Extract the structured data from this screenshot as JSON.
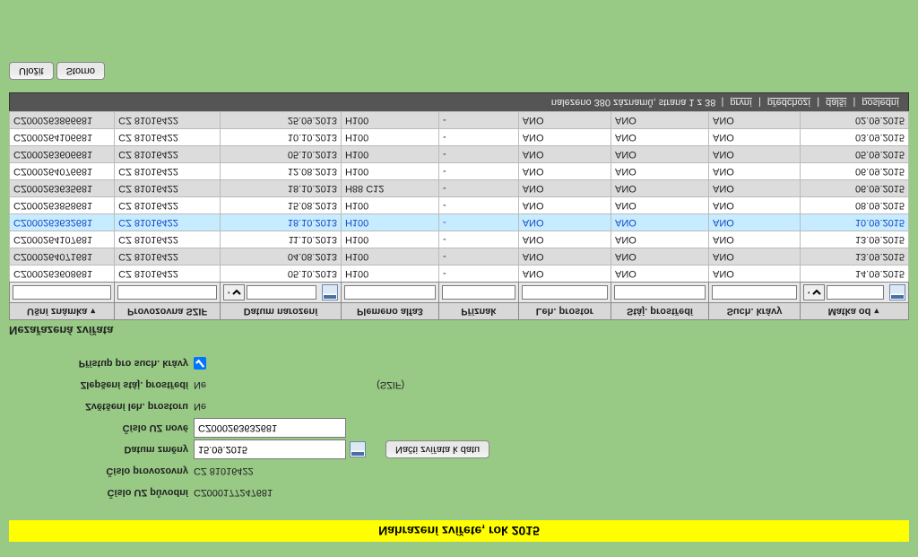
{
  "header": {
    "title": "Nahrazení zvířete, rok 2015"
  },
  "form": {
    "labels": {
      "orig_uz": "Číslo UZ původní",
      "farm_no": "Číslo provozovny",
      "change_date": "Datum změny",
      "new_uz": "Číslo UZ nové",
      "enlarge_space": "Zvětšení leh. prostoru",
      "improve_env": "Zlepšení stáj. prostředí",
      "dry_cows_access": "Přístup pro such. krávy"
    },
    "values": {
      "orig_uz": "CZ000177247681",
      "farm_no": "CZ 81016422",
      "change_date": "15.09.2015",
      "new_uz": "CZ000263632681",
      "enlarge_space": "Ne",
      "improve_env": "Ne",
      "szif_note": "(SZIF)"
    },
    "buttons": {
      "load_animals": "Načti zvířata k datu",
      "save": "Uložit",
      "cancel": "Storno"
    }
  },
  "section_title": "Nezařazená zvířata",
  "columns": {
    "ear_tag": "Ušní známka",
    "farm_szif": "Provozovna SZIF",
    "birth_date": "Datum narození",
    "breed": "Plemeno alfa3",
    "flag": "Příznak",
    "leh_prostor": "Leh. prostor",
    "staj_prostredi": "Stáj. prostředí",
    "such_kravy": "Such. krávy",
    "matka_od": "Matka od"
  },
  "rows": [
    {
      "ear_tag": "CZ000263608681",
      "farm": "CZ 81016422",
      "birth": "05.10.2013",
      "breed": "H100",
      "flag": "-",
      "leh": "ANO",
      "staj": "ANO",
      "such": "ANO",
      "matka": "14.09.2015",
      "alt": false
    },
    {
      "ear_tag": "CZ000264071681",
      "farm": "CZ 81016422",
      "birth": "04.08.2013",
      "breed": "H100",
      "flag": "-",
      "leh": "ANO",
      "staj": "ANO",
      "such": "ANO",
      "matka": "13.09.2015",
      "alt": true
    },
    {
      "ear_tag": "CZ000264107681",
      "farm": "CZ 81016422",
      "birth": "11.10.2013",
      "breed": "H100",
      "flag": "-",
      "leh": "ANO",
      "staj": "ANO",
      "such": "ANO",
      "matka": "13.09.2015",
      "alt": false
    },
    {
      "ear_tag": "CZ000263632681",
      "farm": "CZ 81016422",
      "birth": "18.10.2013",
      "breed": "H100",
      "flag": "-",
      "leh": "ANO",
      "staj": "ANO",
      "such": "ANO",
      "matka": "10.09.2015",
      "selected": true
    },
    {
      "ear_tag": "CZ000263858681",
      "farm": "CZ 81016422",
      "birth": "15.08.2013",
      "breed": "H100",
      "flag": "-",
      "leh": "ANO",
      "staj": "ANO",
      "such": "ANO",
      "matka": "08.09.2015",
      "alt": false
    },
    {
      "ear_tag": "CZ000263635681",
      "farm": "CZ 81016422",
      "birth": "18.10.2013",
      "breed": "H88 C12",
      "flag": "-",
      "leh": "ANO",
      "staj": "ANO",
      "such": "ANO",
      "matka": "06.09.2015",
      "alt": true
    },
    {
      "ear_tag": "CZ000264076681",
      "farm": "CZ 81016422",
      "birth": "12.08.2013",
      "breed": "H100",
      "flag": "-",
      "leh": "ANO",
      "staj": "ANO",
      "such": "ANO",
      "matka": "06.09.2015",
      "alt": false
    },
    {
      "ear_tag": "CZ000263606681",
      "farm": "CZ 81016422",
      "birth": "05.10.2013",
      "breed": "H100",
      "flag": "-",
      "leh": "ANO",
      "staj": "ANO",
      "such": "ANO",
      "matka": "05.09.2015",
      "alt": true
    },
    {
      "ear_tag": "CZ000264106681",
      "farm": "CZ 81016422",
      "birth": "10.10.2013",
      "breed": "H100",
      "flag": "-",
      "leh": "ANO",
      "staj": "ANO",
      "such": "ANO",
      "matka": "03.09.2015",
      "alt": false
    },
    {
      "ear_tag": "CZ000263866681",
      "farm": "CZ 81016422",
      "birth": "25.09.2013",
      "breed": "H100",
      "flag": "-",
      "leh": "ANO",
      "staj": "ANO",
      "such": "ANO",
      "matka": "02.09.2015",
      "alt": true
    }
  ],
  "pager": {
    "summary": "nalezeno 380 záznamů, strana 1 z 38",
    "first": "první",
    "prev": "předchozí",
    "next": "další",
    "last": "poslední"
  }
}
